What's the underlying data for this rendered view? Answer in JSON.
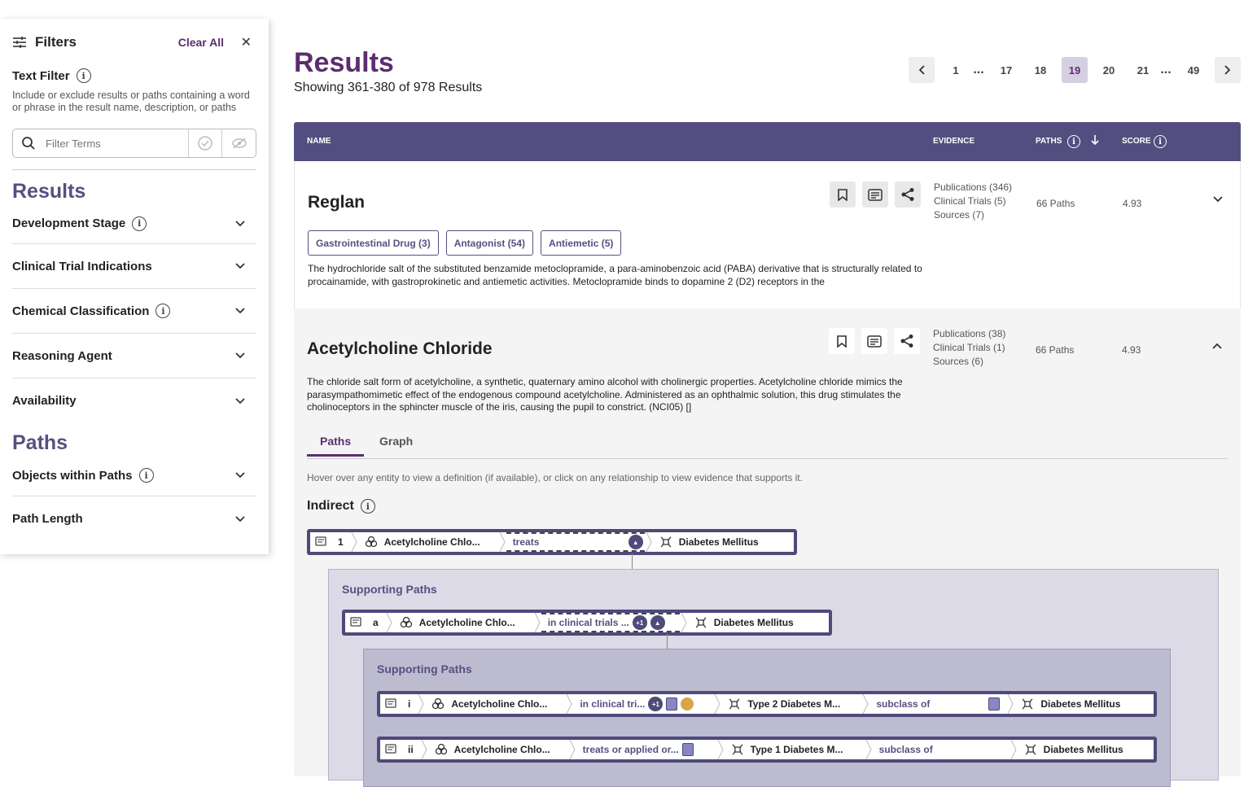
{
  "sidebar": {
    "title": "Filters",
    "clear_all": "Clear All",
    "text_filter": {
      "title": "Text Filter",
      "description": "Include or exclude results or paths containing a word or phrase in the result name, description, or paths",
      "placeholder": "Filter Terms"
    },
    "results_heading": "Results",
    "results_filters": [
      "Development Stage",
      "Clinical Trial Indications",
      "Chemical Classification",
      "Reasoning Agent",
      "Availability"
    ],
    "paths_heading": "Paths",
    "paths_filters": [
      "Objects within Paths",
      "Path Length"
    ]
  },
  "main": {
    "title": "Results",
    "showing": "Showing 361-380 of 978 Results",
    "pagination": {
      "pages": [
        "1",
        "...",
        "17",
        "18",
        "19",
        "20",
        "21",
        "...",
        "49"
      ],
      "current": "19"
    },
    "columns": {
      "name": "NAME",
      "evidence": "EVIDENCE",
      "paths": "PATHS",
      "score": "SCORE"
    },
    "results": [
      {
        "name": "Reglan",
        "tags": [
          "Gastrointestinal Drug (3)",
          "Antagonist (54)",
          "Antiemetic (5)"
        ],
        "description": "The hydrochloride salt of the substituted benzamide metoclopramide, a para-aminobenzoic acid (PABA) derivative that is structurally related to procainamide, with gastroprokinetic and antiemetic activities. Metoclopramide binds to dopamine 2 (D2) receptors in the",
        "evidence": [
          "Publications (346)",
          "Clinical Trials (5)",
          "Sources (7)"
        ],
        "paths": "66 Paths",
        "score": "4.93"
      },
      {
        "name": "Acetylcholine Chloride",
        "description": "The chloride salt form of acetylcholine, a synthetic, quaternary amino alcohol with cholinergic properties. Acetylcholine chloride mimics the parasympathomimetic effect of the endogenous compound acetylcholine. Administered as an ophthalmic solution, this drug stimulates the cholinoceptors in the sphincter muscle of the iris, causing the pupil to constrict. (NCI05) []",
        "evidence": [
          "Publications (38)",
          "Clinical Trials (1)",
          "Sources (6)"
        ],
        "paths": "66 Paths",
        "score": "4.93"
      }
    ],
    "tabs": [
      "Paths",
      "Graph"
    ],
    "hint": "Hover over any entity to view a definition (if available), or click on any relationship to view evidence that supports it.",
    "indirect_label": "Indirect",
    "supporting_label": "Supporting Paths",
    "path_rows": {
      "p1": {
        "id": "1",
        "subject": "Acetylcholine Chlo...",
        "rel": "treats",
        "object": "Diabetes Mellitus"
      },
      "pa": {
        "id": "a",
        "subject": "Acetylcholine Chlo...",
        "rel": "in clinical trials ...",
        "badge": "+1",
        "object": "Diabetes Mellitus"
      },
      "pi": {
        "id": "i",
        "subject": "Acetylcholine Chlo...",
        "rel": "in clinical tri...",
        "badge": "+1",
        "mid": "Type 2 Diabetes M...",
        "rel2": "subclass of",
        "object": "Diabetes Mellitus"
      },
      "pii": {
        "id": "ii",
        "subject": "Acetylcholine Chlo...",
        "rel": "treats or applied or...",
        "mid": "Type 1 Diabetes M...",
        "rel2": "subclass of",
        "object": "Diabetes Mellitus"
      }
    }
  }
}
